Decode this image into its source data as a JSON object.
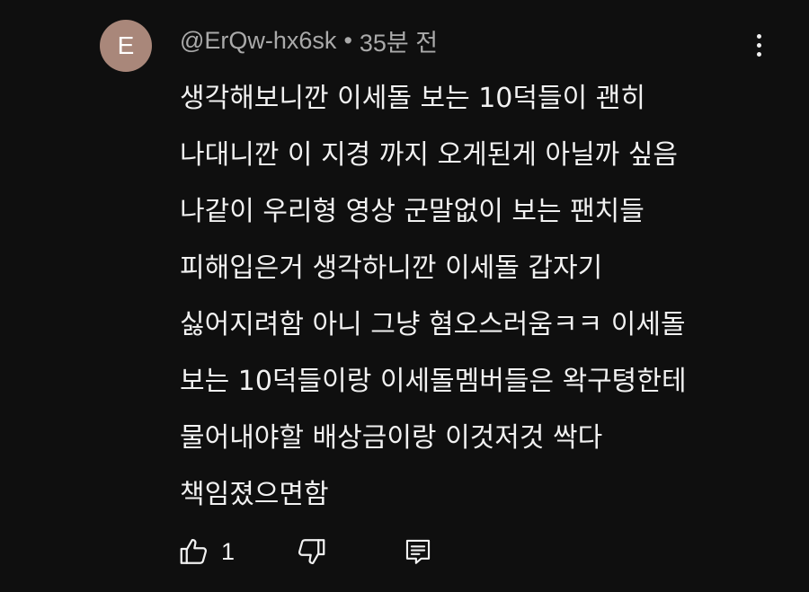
{
  "comment": {
    "avatar_letter": "E",
    "avatar_color": "#a9877a",
    "author": "@ErQw-hx6sk",
    "separator": "•",
    "timestamp": "35분 전",
    "lines": [
      "생각해보니깐 이세돌 보는 10덕들이 괜히",
      "나대니깐 이 지경 까지 오게된게 아닐까 싶음",
      "나같이 우리형 영상 군말없이 보는 팬치들",
      "피해입은거 생각하니깐 이세돌 갑자기",
      "싫어지려함 아니 그냥 혐오스러움ㅋㅋ 이세돌",
      "보는 10덕들이랑 이세돌멤버들은 왁구텽한테",
      "물어내야할 배상금이랑 이것저것 싹다",
      "책임졌으면함"
    ],
    "like_count": "1",
    "icons": {
      "like": "thumbs-up-icon",
      "dislike": "thumbs-down-icon",
      "reply": "reply-icon",
      "more": "more-vert-icon"
    }
  }
}
